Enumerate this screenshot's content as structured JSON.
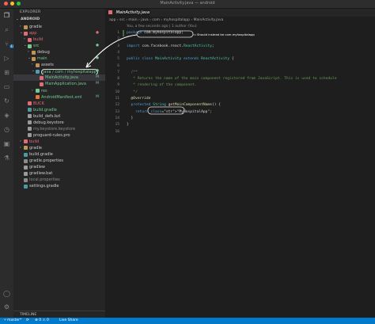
{
  "window": {
    "title": "MainActivity.java — android"
  },
  "activity_bar": {
    "badge": "44"
  },
  "explorer": {
    "header": "EXPLORER",
    "project": "ANDROID",
    "items": [
      {
        "label": "gradle",
        "depth": 1,
        "chev": "›",
        "icon": "folder",
        "status": ""
      },
      {
        "label": "app",
        "depth": 1,
        "chev": "⌄",
        "icon": "folder-red",
        "status": "●",
        "color": "#e06c75"
      },
      {
        "label": "build",
        "depth": 2,
        "chev": "›",
        "icon": "folder-red",
        "status": "",
        "color": "#e06c75"
      },
      {
        "label": "src",
        "depth": 2,
        "chev": "⌄",
        "icon": "folder-green",
        "status": "●",
        "color": "#73c991"
      },
      {
        "label": "debug",
        "depth": 3,
        "chev": "›",
        "icon": "folder",
        "status": ""
      },
      {
        "label": "main",
        "depth": 3,
        "chev": "⌄",
        "icon": "folder",
        "status": "●",
        "color": "#73c991"
      },
      {
        "label": "assets",
        "depth": 4,
        "chev": "›",
        "icon": "folder",
        "status": ""
      },
      {
        "label": "java / com / myhospitalapp",
        "depth": 4,
        "chev": "⌄",
        "icon": "folder-blue",
        "status": "●",
        "color": "#73c991",
        "highlight": true
      },
      {
        "label": "MainActivity.java",
        "depth": 5,
        "chev": "",
        "icon": "java",
        "status": "M",
        "color": "#73c991",
        "selected": true
      },
      {
        "label": "MainApplication.java",
        "depth": 5,
        "chev": "",
        "icon": "java",
        "status": "M",
        "color": "#73c991"
      },
      {
        "label": "res",
        "depth": 4,
        "chev": "›",
        "icon": "folder-green",
        "status": "",
        "color": "#73c991"
      },
      {
        "label": "AndroidManifest.xml",
        "depth": 4,
        "chev": "",
        "icon": "xml",
        "status": "M",
        "color": "#73c991"
      },
      {
        "label": "BUCK",
        "depth": 2,
        "chev": "",
        "icon": "file-red",
        "status": "",
        "color": "#e06c75"
      },
      {
        "label": "build.gradle",
        "depth": 2,
        "chev": "",
        "icon": "gradle",
        "status": "",
        "color": "#73c991"
      },
      {
        "label": "build_defs.bzl",
        "depth": 2,
        "chev": "",
        "icon": "file",
        "status": ""
      },
      {
        "label": "debug.keystore",
        "depth": 2,
        "chev": "",
        "icon": "file",
        "status": ""
      },
      {
        "label": "my.keystore.keystore",
        "depth": 2,
        "chev": "",
        "icon": "file",
        "status": "",
        "color": "#8b8b8b"
      },
      {
        "label": "proguard-rules.pro",
        "depth": 2,
        "chev": "",
        "icon": "file",
        "status": ""
      },
      {
        "label": "build",
        "depth": 1,
        "chev": "›",
        "icon": "folder-red",
        "status": "",
        "color": "#e06c75"
      },
      {
        "label": "gradle",
        "depth": 1,
        "chev": "›",
        "icon": "folder",
        "status": ""
      },
      {
        "label": "build.gradle",
        "depth": 1,
        "chev": "",
        "icon": "gradle",
        "status": ""
      },
      {
        "label": "gradle.properties",
        "depth": 1,
        "chev": "",
        "icon": "gear",
        "status": ""
      },
      {
        "label": "gradlew",
        "depth": 1,
        "chev": "",
        "icon": "file",
        "status": ""
      },
      {
        "label": "gradlew.bat",
        "depth": 1,
        "chev": "",
        "icon": "file",
        "status": ""
      },
      {
        "label": "local.properties",
        "depth": 1,
        "chev": "",
        "icon": "gear",
        "status": "",
        "color": "#8b8b8b"
      },
      {
        "label": "settings.gradle",
        "depth": 1,
        "chev": "",
        "icon": "gradle",
        "status": ""
      }
    ],
    "timeline": "TIMELINE"
  },
  "editor": {
    "tab": "MainActivity.java",
    "breadcrumb": "app › src › main › java › com › myhospitalapp › MainActivity.java",
    "blame": "You, a few seconds ago | 1 author (You)",
    "lines": [
      {
        "n": "1",
        "t": "package com.myhospitalapp;",
        "cls": "pl"
      },
      {
        "n": "2",
        "t": "",
        "cls": "pl"
      },
      {
        "n": "3",
        "t": "import com.facebook.react.ReactActivity;",
        "cls": "pl"
      },
      {
        "n": "4",
        "t": "",
        "cls": "pl"
      },
      {
        "n": "5",
        "t": "public class MainActivity extends ReactActivity {",
        "cls": "pl"
      },
      {
        "n": "6",
        "t": "",
        "cls": "pl"
      },
      {
        "n": "7",
        "t": "  /**",
        "cls": "cm"
      },
      {
        "n": "8",
        "t": "   * Returns the name of the main component registered from JavaScript. This is used to schedule",
        "cls": "cm"
      },
      {
        "n": "9",
        "t": "   * rendering of the component.",
        "cls": "cm"
      },
      {
        "n": "10",
        "t": "   */",
        "cls": "cm"
      },
      {
        "n": "11",
        "t": "  @Override",
        "cls": "an"
      },
      {
        "n": "12",
        "t": "  protected String getMainComponentName() {",
        "cls": "pl"
      },
      {
        "n": "13",
        "t": "    return \"MyHospitalApp\";",
        "cls": "pl"
      },
      {
        "n": "14",
        "t": "  }",
        "cls": "pl"
      },
      {
        "n": "15",
        "t": "}",
        "cls": "pl"
      },
      {
        "n": "16",
        "t": "",
        "cls": "pl"
      }
    ],
    "annotation": "Should instead be com.myhospitalapp"
  },
  "status": {
    "branch": "master*",
    "sync": "⟳",
    "problems": "⊗ 0  ⚠ 0",
    "live_share": "Live Share"
  },
  "colors": {
    "accent": "#007acc",
    "annotation": "#ffffff",
    "highlight_box": "#e0e0e0"
  }
}
